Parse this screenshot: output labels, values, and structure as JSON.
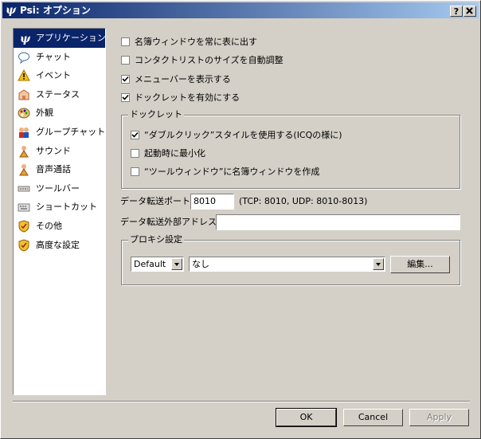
{
  "window": {
    "title": "Psi: オプション",
    "help_label": "?",
    "close_label": "X"
  },
  "sidebar": {
    "items": [
      {
        "label": "アプリケーション",
        "icon": "psi-logo-icon"
      },
      {
        "label": "チャット",
        "icon": "chat-bubble-icon"
      },
      {
        "label": "イベント",
        "icon": "warning-icon"
      },
      {
        "label": "ステータス",
        "icon": "status-icon"
      },
      {
        "label": "外観",
        "icon": "palette-icon"
      },
      {
        "label": "グループチャット",
        "icon": "group-chat-icon"
      },
      {
        "label": "サウンド",
        "icon": "sound-icon"
      },
      {
        "label": "音声通話",
        "icon": "voice-call-icon"
      },
      {
        "label": "ツールバー",
        "icon": "toolbar-icon"
      },
      {
        "label": "ショートカット",
        "icon": "shortcut-icon"
      },
      {
        "label": "その他",
        "icon": "shield-icon"
      },
      {
        "label": "高度な設定",
        "icon": "shield-icon"
      }
    ]
  },
  "options": {
    "roster_on_top": {
      "label": "名簿ウィンドウを常に表に出す",
      "checked": false
    },
    "auto_resize": {
      "label": "コンタクトリストのサイズを自動調整",
      "checked": false
    },
    "show_menubar": {
      "label": "メニューバーを表示する",
      "checked": true
    },
    "enable_docklet": {
      "label": "ドックレットを有効にする",
      "checked": true
    }
  },
  "docklet": {
    "title": "ドックレット",
    "double_click": {
      "label": "“ダブルクリック”スタイルを使用する(ICQの様に)",
      "checked": true
    },
    "start_minimized": {
      "label": "起動時に最小化",
      "checked": false
    },
    "toolwindow": {
      "label": "“ツールウィンドウ”に名簿ウィンドウを作成",
      "checked": false
    }
  },
  "transfer": {
    "port_label": "データ転送ポート:",
    "port_value": "8010",
    "port_info": "(TCP: 8010, UDP: 8010-8013)",
    "external_label": "データ転送外部アドレス:",
    "external_value": ""
  },
  "proxy": {
    "title": "プロキシ設定",
    "type_value": "Default",
    "proxy_value": "なし",
    "edit_label": "編集..."
  },
  "buttons": {
    "ok": "OK",
    "cancel": "Cancel",
    "apply": "Apply"
  },
  "colors": {
    "selection": "#0a246a",
    "face": "#d4d0c8",
    "title_gradient_end": "#a6caf0"
  }
}
